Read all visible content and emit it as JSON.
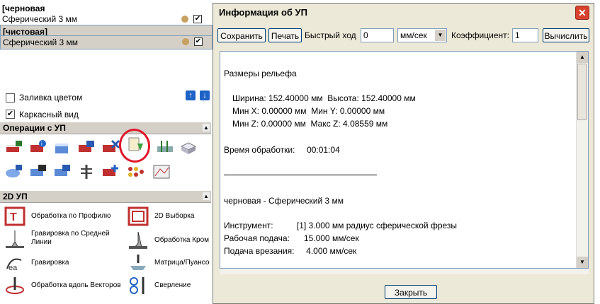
{
  "left_panel": {
    "toolpaths": [
      {
        "group": "[черновая",
        "item": "Сферический 3 мм"
      },
      {
        "group": "[чистовая]",
        "item": "Сферический 3 мм"
      }
    ],
    "color_fill_label": "Заливка цветом",
    "color_fill_checked": "",
    "wireframe_label": "Каркасный вид",
    "wireframe_checked": "✔",
    "operations_title": "Операции с УП",
    "section_2d_title": "2D УП",
    "tools": [
      {
        "label": "Обработка по Профилю",
        "icon": "profile-icon"
      },
      {
        "label": "2D Выборка",
        "icon": "pocket-icon"
      },
      {
        "label": "Гравировка по Средней\nЛинии",
        "icon": "centerline-engrave-icon"
      },
      {
        "label": "Обработка Кром",
        "icon": "edge-machining-icon"
      },
      {
        "label": "Гравировка",
        "icon": "engrave-icon"
      },
      {
        "label": "Матрица/Пуансо",
        "icon": "matrix-punch-icon"
      },
      {
        "label": "Обработка вдоль Векторов",
        "icon": "vector-machining-icon"
      },
      {
        "label": "Сверление",
        "icon": "drilling-icon"
      }
    ],
    "colors": {
      "accent_blue": "#1f63c6",
      "annotation_red": "#e0182a"
    }
  },
  "dialog": {
    "title": "Информация об УП",
    "toolbar": {
      "save_label": "Сохранить",
      "print_label": "Печать",
      "rapid_label": "Быстрый ход",
      "rapid_value": "0",
      "units_value": "мм/сек",
      "coeff_label": "Коэффициент:",
      "coeff_value": "1",
      "calc_label": "Вычислить"
    },
    "report": {
      "relief_heading": "Размеры рельефа",
      "width_line": "Ширина: 152.40000 мм  Высота: 152.40000 мм",
      "min_xy_line": "Мин X: 0.00000 мм  Мин Y: 0.00000 мм",
      "min_max_z_line": "Мин Z: 0.00000 мм  Макс Z: 4.08559 мм",
      "time_line": "Время обработки:     00:01:04",
      "toolpath_name": "черновая - Сферический 3 мм",
      "tool_line": "Инструмент:          [1] 3.000 мм радиус сферической фрезы",
      "feed_line": "Рабочая подача:      15.000 мм/сек",
      "plunge_line": "Подача врезания:     4.000 мм/сек"
    },
    "close_label": "Закрыть",
    "colors": {
      "close_red": "#d9412f",
      "dialog_bg": "#ece9d8"
    }
  }
}
